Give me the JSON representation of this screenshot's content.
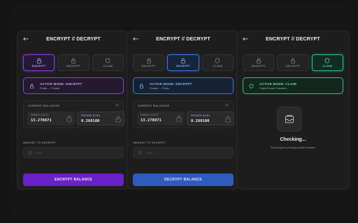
{
  "colors": {
    "purple": "#8b3fe0",
    "blue": "#3c7ae8",
    "green": "#2bc58a",
    "background": "#141414",
    "panel": "#1d1d1d"
  },
  "panels": [
    {
      "back_icon": "back-arrow-icon",
      "title": "ENCRYPT // DECRYPT",
      "tabs": [
        {
          "label": "ENCRYPT",
          "icon": "lock-icon",
          "active": true
        },
        {
          "label": "DECRYPT",
          "icon": "lock-icon",
          "active": false
        },
        {
          "label": "CLAIM",
          "icon": "shield-icon",
          "active": false
        }
      ],
      "mode": {
        "title": "ACTIVE MODE: ENCRYPT",
        "subtitle": "Public → Private",
        "icon": "lock-icon"
      },
      "balances_label": "CURRENT BALANCES",
      "refresh_icon": "refresh-icon",
      "public_label": "PUBLIC (OCT)",
      "public_value": "13.278871",
      "private_label": "PRIVATE (FHE)",
      "private_value": "0.260100",
      "amount_label": "AMOUNT TO ENCRYPT",
      "amount_placeholder": "0.00",
      "action_label": "ENCRYPT BALANCE"
    },
    {
      "back_icon": "back-arrow-icon",
      "title": "ENCRYPT // DECRYPT",
      "tabs": [
        {
          "label": "ENCRYPT",
          "icon": "lock-icon",
          "active": false
        },
        {
          "label": "DECRYPT",
          "icon": "unlock-icon",
          "active": true
        },
        {
          "label": "CLAIM",
          "icon": "shield-icon",
          "active": false
        }
      ],
      "mode": {
        "title": "ACTIVE MODE: DECRYPT",
        "subtitle": "Private → Public",
        "icon": "unlock-icon"
      },
      "balances_label": "CURRENT BALANCES",
      "refresh_icon": "refresh-icon",
      "public_label": "PUBLIC (OCT)",
      "public_value": "13.278871",
      "private_label": "PRIVATE (FHE)",
      "private_value": "0.260100",
      "amount_label": "AMOUNT TO DECRYPT",
      "amount_placeholder": "0.00",
      "action_label": "DECRYPT BALANCE"
    },
    {
      "back_icon": "back-arrow-icon",
      "title": "ENCRYPT // DECRYPT",
      "tabs": [
        {
          "label": "ENCRYPT",
          "icon": "lock-icon",
          "active": false
        },
        {
          "label": "DECRYPT",
          "icon": "unlock-icon",
          "active": false
        },
        {
          "label": "CLAIM",
          "icon": "shield-icon",
          "active": true
        }
      ],
      "mode": {
        "title": "ACTIVE MODE: CLAIM",
        "subtitle": "Claim Private Transfers",
        "icon": "shield-icon"
      },
      "checking_icon": "inbox-icon",
      "checking_title": "Checking...",
      "checking_subtitle": "Scanning for pending private transfers"
    }
  ]
}
